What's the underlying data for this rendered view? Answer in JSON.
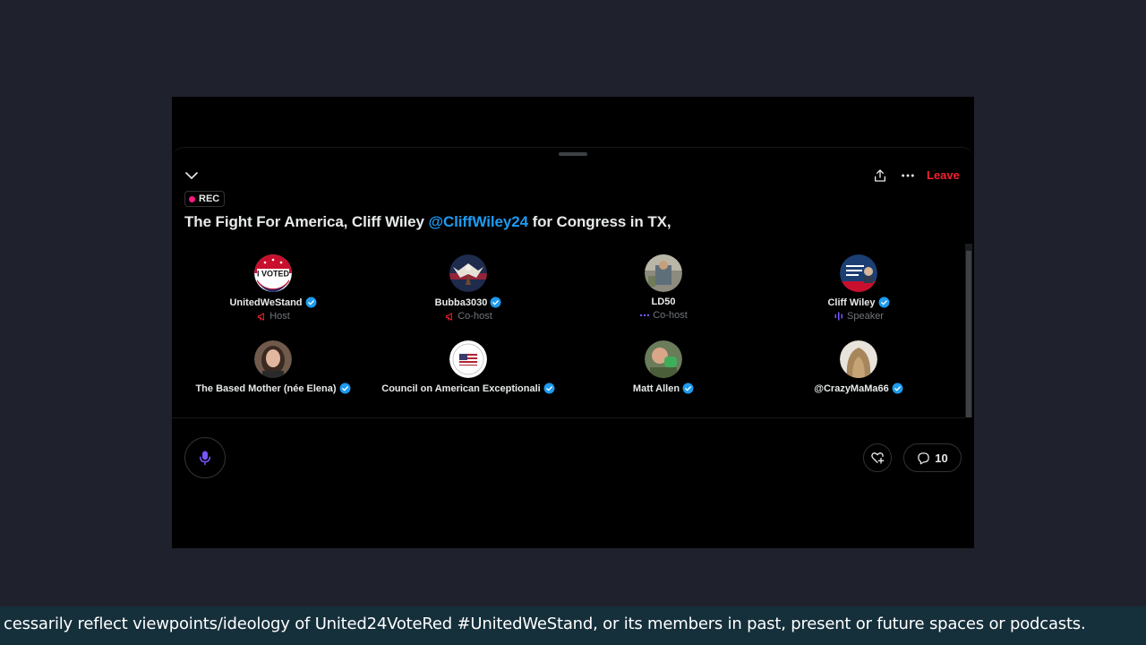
{
  "space": {
    "leave_label": "Leave",
    "rec_label": "REC",
    "title_prefix": "The Fight For America, Cliff Wiley ",
    "title_mention": "@CliffWiley24",
    "title_suffix": " for Congress in TX,"
  },
  "participants": [
    {
      "name": "UnitedWeStand",
      "role": "Host",
      "role_icon": "megaphone-icon"
    },
    {
      "name": "Bubba3030",
      "role": "Co-host",
      "role_icon": "megaphone-icon"
    },
    {
      "name": "LD50",
      "role": "Co-host",
      "role_icon": "dots-icon"
    },
    {
      "name": "Cliff Wiley",
      "role": "Speaker",
      "role_icon": "soundwave-icon"
    },
    {
      "name": "The Based Mother (née Elena)",
      "role": "",
      "role_icon": ""
    },
    {
      "name": "Council on American Exceptionali",
      "role": "",
      "role_icon": ""
    },
    {
      "name": "Matt Allen",
      "role": "",
      "role_icon": ""
    },
    {
      "name": "@CrazyMaMa66",
      "role": "",
      "role_icon": ""
    }
  ],
  "footer": {
    "comment_count": "10"
  },
  "ticker": {
    "text": "cessarily reflect viewpoints/ideology of United24VoteRed #UnitedWeStand, or its members in past, present or future spaces or podcasts."
  },
  "colors": {
    "accent_blue": "#1d9bf0",
    "leave_red": "#f4212e",
    "mic_purple": "#7856ff",
    "host_red": "#f4212e",
    "ticker_bg": "#152f3b"
  }
}
